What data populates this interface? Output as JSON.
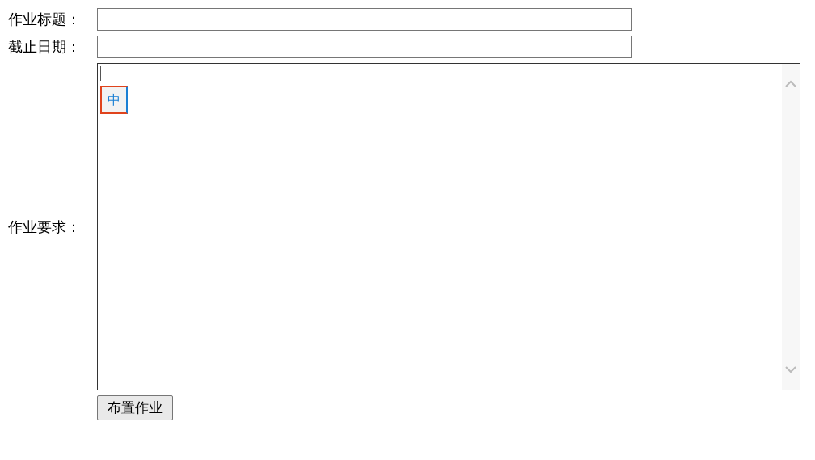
{
  "fields": [
    {
      "label": "作业标题："
    },
    {
      "label": "截止日期："
    }
  ],
  "requirements": {
    "label": "作业要求：",
    "ime_indicator": "中"
  },
  "submit_button": "布置作业"
}
